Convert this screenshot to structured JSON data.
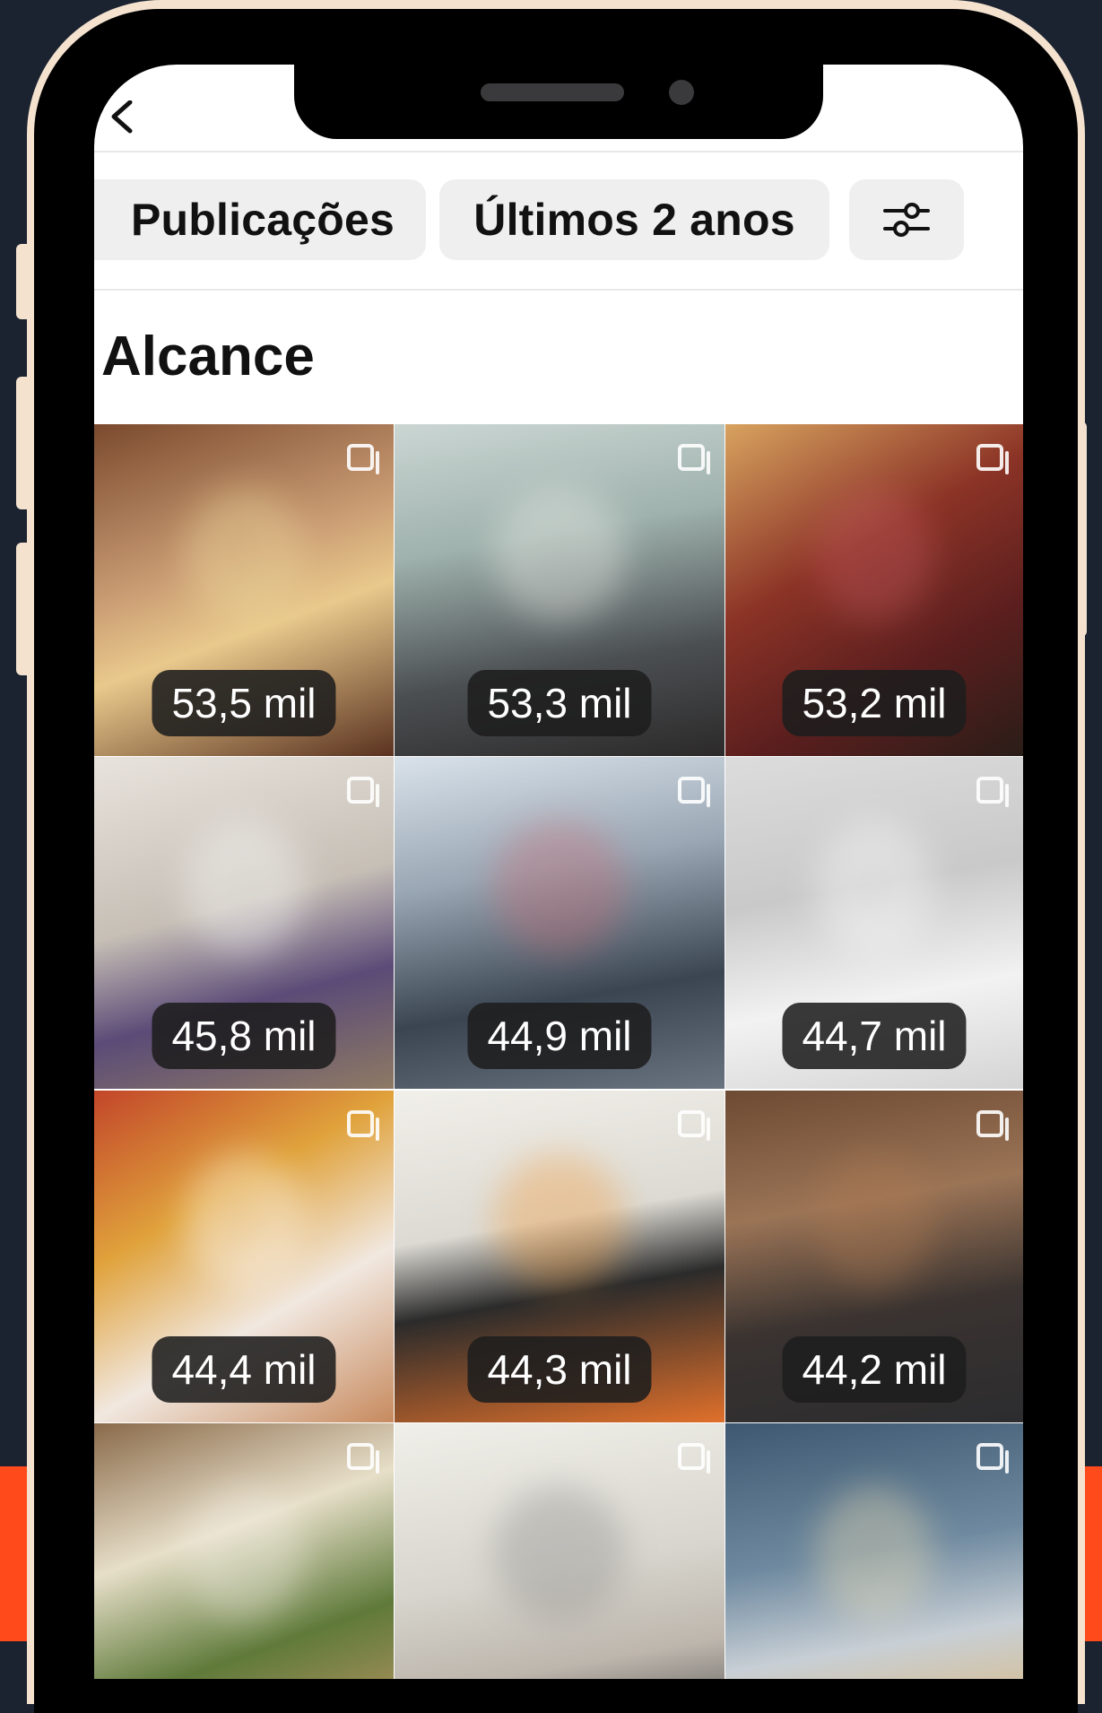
{
  "filters": {
    "content_type": "Publicações",
    "period": "Últimos 2 anos",
    "adjust_icon": "sliders-icon"
  },
  "section_title": "Alcance",
  "posts": [
    {
      "reach": "53,5 mil",
      "bg": "linear-gradient(160deg,#7b4a2e 0%,#c89a72 40%,#e9c98c 60%,#5a3220 100%)",
      "accent": "#f1dfa0"
    },
    {
      "reach": "53,3 mil",
      "bg": "linear-gradient(170deg,#cbd6d3 0%,#9fb2ad 35%,#4b4f52 70%,#2c2a2a 100%)",
      "accent": "#f3f1ec"
    },
    {
      "reach": "53,2 mil",
      "bg": "linear-gradient(150deg,#d8a35f 0%,#8b3326 40%,#5a1e1e 70%,#2a1d18 100%)",
      "accent": "#c55b64"
    },
    {
      "reach": "45,8 mil",
      "bg": "linear-gradient(165deg,#e8e3dc 0%,#c6bfb6 45%,#5b4b77 70%,#8e7a64 100%)",
      "accent": "#ffffff"
    },
    {
      "reach": "44,9 mil",
      "bg": "linear-gradient(170deg,#d9e2ea 0%,#9aa7b4 35%,#3b4552 70%,#6a7480 100%)",
      "accent": "#c96b72"
    },
    {
      "reach": "44,7 mil",
      "bg": "linear-gradient(170deg,#dcdcdc 0%,#c9c9c9 40%,#f2f2f2 70%,#d4d4d4 100%)",
      "accent": "#ffffff"
    },
    {
      "reach": "44,4 mil",
      "bg": "linear-gradient(150deg,#c2462a 0%,#e0a23b 35%,#f1e8e0 65%,#c78a5e 100%)",
      "accent": "#ffffff"
    },
    {
      "reach": "44,3 mil",
      "bg": "linear-gradient(170deg,#f1efe9 0%,#dcdad3 40%,#2b2b2b 60%,#e0702b 100%)",
      "accent": "#f29a3a"
    },
    {
      "reach": "44,2 mil",
      "bg": "linear-gradient(170deg,#6d4a33 0%,#9b7456 35%,#3a3330 65%,#2c2c2f 100%)",
      "accent": "#b07b52"
    },
    {
      "reach": "",
      "bg": "linear-gradient(160deg,#8a6a4a 0%,#e7dfc9 35%,#5f7a3a 65%,#c79a6a 100%)",
      "accent": "#f3efe6"
    },
    {
      "reach": "",
      "bg": "linear-gradient(170deg,#f0efe9 0%,#d7d5cd 45%,#bdb6ad 70%,#3a3a3a 100%)",
      "accent": "#8a8a8a"
    },
    {
      "reach": "",
      "bg": "linear-gradient(170deg,#3d5870 0%,#6f8aa0 40%,#c8cfd5 65%,#e0b36a 100%)",
      "accent": "#f5e3b4"
    }
  ]
}
